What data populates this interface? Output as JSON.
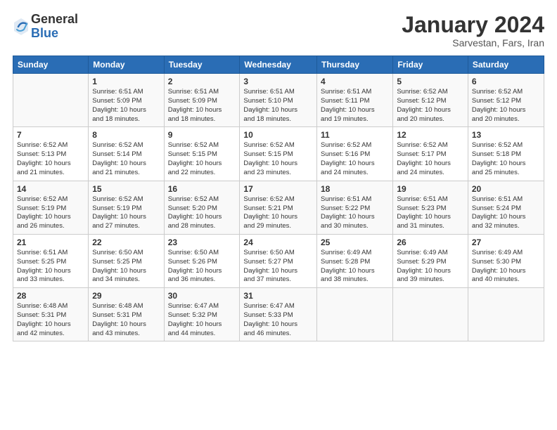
{
  "logo": {
    "general": "General",
    "blue": "Blue"
  },
  "title": {
    "month": "January 2024",
    "location": "Sarvestan, Fars, Iran"
  },
  "weekdays": [
    "Sunday",
    "Monday",
    "Tuesday",
    "Wednesday",
    "Thursday",
    "Friday",
    "Saturday"
  ],
  "weeks": [
    [
      {
        "day": "",
        "info": ""
      },
      {
        "day": "1",
        "info": "Sunrise: 6:51 AM\nSunset: 5:09 PM\nDaylight: 10 hours\nand 18 minutes."
      },
      {
        "day": "2",
        "info": "Sunrise: 6:51 AM\nSunset: 5:09 PM\nDaylight: 10 hours\nand 18 minutes."
      },
      {
        "day": "3",
        "info": "Sunrise: 6:51 AM\nSunset: 5:10 PM\nDaylight: 10 hours\nand 18 minutes."
      },
      {
        "day": "4",
        "info": "Sunrise: 6:51 AM\nSunset: 5:11 PM\nDaylight: 10 hours\nand 19 minutes."
      },
      {
        "day": "5",
        "info": "Sunrise: 6:52 AM\nSunset: 5:12 PM\nDaylight: 10 hours\nand 20 minutes."
      },
      {
        "day": "6",
        "info": "Sunrise: 6:52 AM\nSunset: 5:12 PM\nDaylight: 10 hours\nand 20 minutes."
      }
    ],
    [
      {
        "day": "7",
        "info": "Sunrise: 6:52 AM\nSunset: 5:13 PM\nDaylight: 10 hours\nand 21 minutes."
      },
      {
        "day": "8",
        "info": "Sunrise: 6:52 AM\nSunset: 5:14 PM\nDaylight: 10 hours\nand 21 minutes."
      },
      {
        "day": "9",
        "info": "Sunrise: 6:52 AM\nSunset: 5:15 PM\nDaylight: 10 hours\nand 22 minutes."
      },
      {
        "day": "10",
        "info": "Sunrise: 6:52 AM\nSunset: 5:15 PM\nDaylight: 10 hours\nand 23 minutes."
      },
      {
        "day": "11",
        "info": "Sunrise: 6:52 AM\nSunset: 5:16 PM\nDaylight: 10 hours\nand 24 minutes."
      },
      {
        "day": "12",
        "info": "Sunrise: 6:52 AM\nSunset: 5:17 PM\nDaylight: 10 hours\nand 24 minutes."
      },
      {
        "day": "13",
        "info": "Sunrise: 6:52 AM\nSunset: 5:18 PM\nDaylight: 10 hours\nand 25 minutes."
      }
    ],
    [
      {
        "day": "14",
        "info": "Sunrise: 6:52 AM\nSunset: 5:19 PM\nDaylight: 10 hours\nand 26 minutes."
      },
      {
        "day": "15",
        "info": "Sunrise: 6:52 AM\nSunset: 5:19 PM\nDaylight: 10 hours\nand 27 minutes."
      },
      {
        "day": "16",
        "info": "Sunrise: 6:52 AM\nSunset: 5:20 PM\nDaylight: 10 hours\nand 28 minutes."
      },
      {
        "day": "17",
        "info": "Sunrise: 6:52 AM\nSunset: 5:21 PM\nDaylight: 10 hours\nand 29 minutes."
      },
      {
        "day": "18",
        "info": "Sunrise: 6:51 AM\nSunset: 5:22 PM\nDaylight: 10 hours\nand 30 minutes."
      },
      {
        "day": "19",
        "info": "Sunrise: 6:51 AM\nSunset: 5:23 PM\nDaylight: 10 hours\nand 31 minutes."
      },
      {
        "day": "20",
        "info": "Sunrise: 6:51 AM\nSunset: 5:24 PM\nDaylight: 10 hours\nand 32 minutes."
      }
    ],
    [
      {
        "day": "21",
        "info": "Sunrise: 6:51 AM\nSunset: 5:25 PM\nDaylight: 10 hours\nand 33 minutes."
      },
      {
        "day": "22",
        "info": "Sunrise: 6:50 AM\nSunset: 5:25 PM\nDaylight: 10 hours\nand 34 minutes."
      },
      {
        "day": "23",
        "info": "Sunrise: 6:50 AM\nSunset: 5:26 PM\nDaylight: 10 hours\nand 36 minutes."
      },
      {
        "day": "24",
        "info": "Sunrise: 6:50 AM\nSunset: 5:27 PM\nDaylight: 10 hours\nand 37 minutes."
      },
      {
        "day": "25",
        "info": "Sunrise: 6:49 AM\nSunset: 5:28 PM\nDaylight: 10 hours\nand 38 minutes."
      },
      {
        "day": "26",
        "info": "Sunrise: 6:49 AM\nSunset: 5:29 PM\nDaylight: 10 hours\nand 39 minutes."
      },
      {
        "day": "27",
        "info": "Sunrise: 6:49 AM\nSunset: 5:30 PM\nDaylight: 10 hours\nand 40 minutes."
      }
    ],
    [
      {
        "day": "28",
        "info": "Sunrise: 6:48 AM\nSunset: 5:31 PM\nDaylight: 10 hours\nand 42 minutes."
      },
      {
        "day": "29",
        "info": "Sunrise: 6:48 AM\nSunset: 5:31 PM\nDaylight: 10 hours\nand 43 minutes."
      },
      {
        "day": "30",
        "info": "Sunrise: 6:47 AM\nSunset: 5:32 PM\nDaylight: 10 hours\nand 44 minutes."
      },
      {
        "day": "31",
        "info": "Sunrise: 6:47 AM\nSunset: 5:33 PM\nDaylight: 10 hours\nand 46 minutes."
      },
      {
        "day": "",
        "info": ""
      },
      {
        "day": "",
        "info": ""
      },
      {
        "day": "",
        "info": ""
      }
    ]
  ]
}
